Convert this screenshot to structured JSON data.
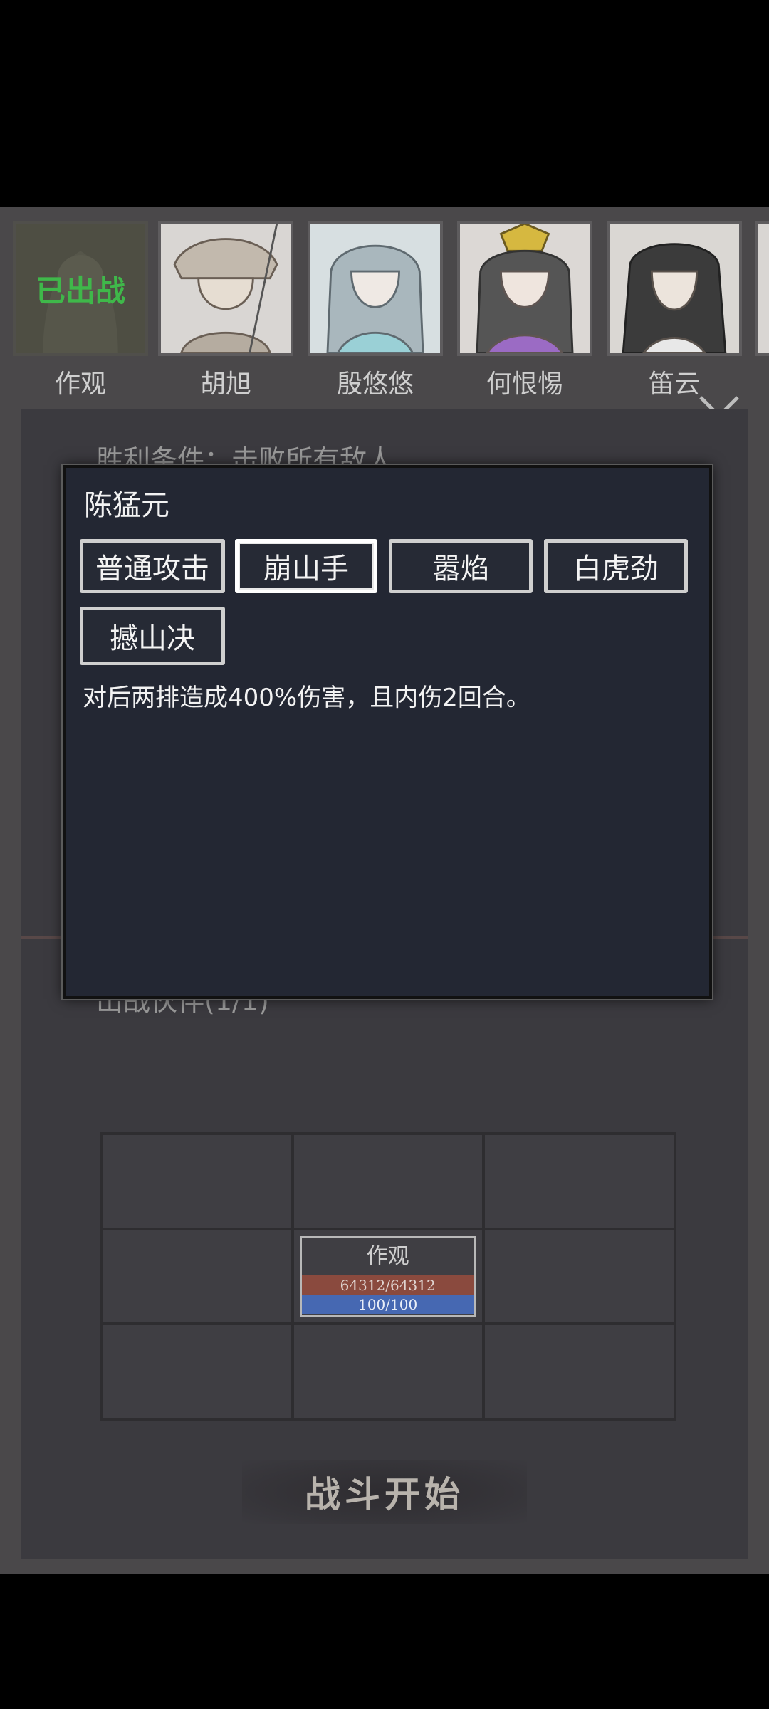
{
  "heroes": [
    {
      "name": "作观",
      "status": "已出战"
    },
    {
      "name": "胡旭"
    },
    {
      "name": "殷悠悠"
    },
    {
      "name": "何恨惕"
    },
    {
      "name": "笛云"
    }
  ],
  "background": {
    "victory_text": "胜利条件：击败所有敌人",
    "companions_text": "出战伙伴(1/1)"
  },
  "modal": {
    "title": "陈猛元",
    "skills": [
      "普通攻击",
      "崩山手",
      "嚣焰",
      "白虎劲",
      "撼山决"
    ],
    "selected_skill_index": 1,
    "description": "对后两排造成400%伤害，且内伤2回合。"
  },
  "formation": {
    "unit": {
      "name": "作观",
      "hp": "64312/64312",
      "mp": "100/100"
    }
  },
  "start_button": "战斗开始",
  "colors": {
    "deployed_text": "#3fb84a",
    "hp_bar": "#8a4a3e",
    "mp_bar": "#4668b2",
    "modal_bg": "#232733"
  }
}
